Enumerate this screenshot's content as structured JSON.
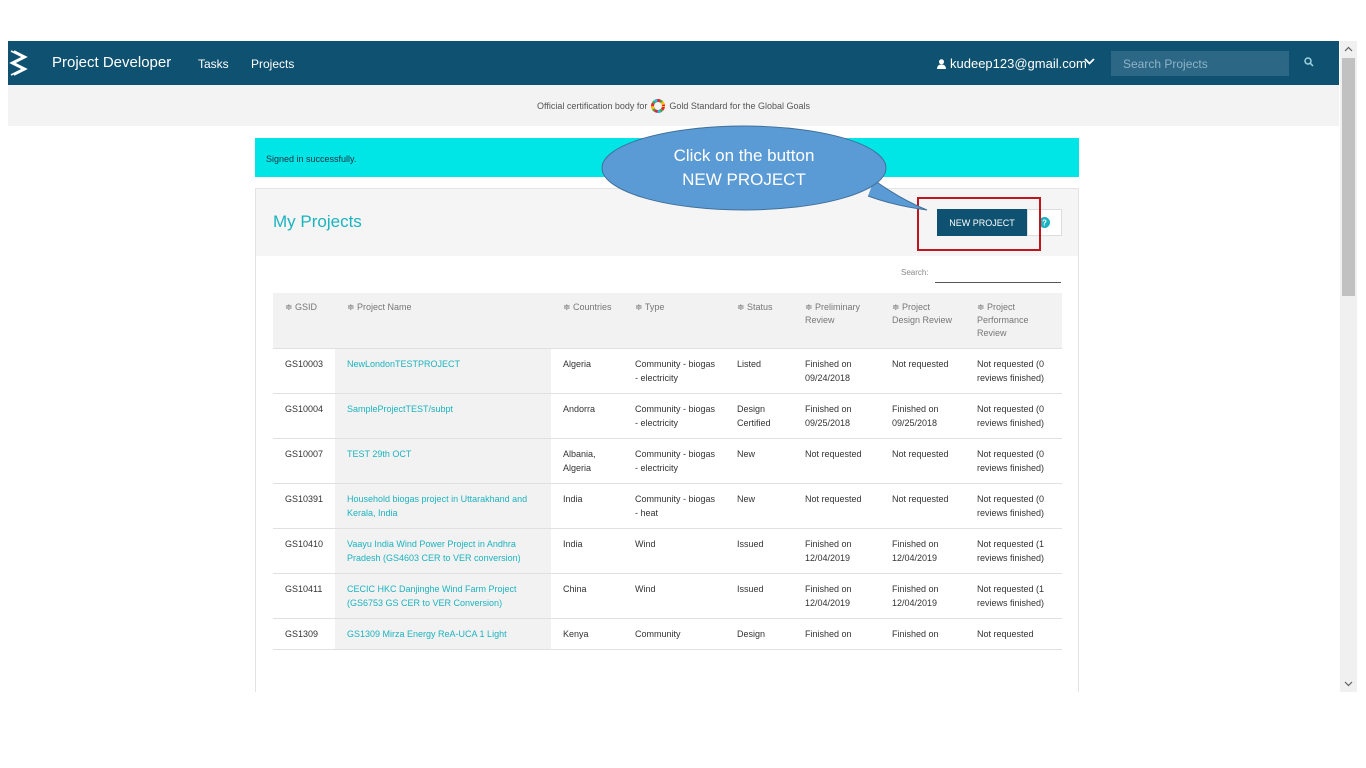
{
  "nav": {
    "brand": "Project Developer",
    "links": [
      "Tasks",
      "Projects"
    ],
    "user_email": "kudeep123@gmail.com",
    "search_placeholder": "Search Projects"
  },
  "cert_bar": {
    "prefix": "Official certification body for",
    "org": "Gold Standard for the Global Goals"
  },
  "alert": "Signed in successfully.",
  "panel": {
    "title": "My Projects",
    "new_project_label": "NEW PROJECT",
    "search_label": "Search:"
  },
  "callout": {
    "line1": "Click on the button",
    "line2": "NEW PROJECT"
  },
  "table": {
    "headers": [
      "≑ GSID",
      "≑ Project Name",
      "≑ Countries",
      "≑ Type",
      "≑ Status",
      "≑ Preliminary Review",
      "≑ Project Design Review",
      "≑ Project Performance Review"
    ],
    "rows": [
      [
        "GS10003",
        "NewLondonTESTPROJECT",
        "Algeria",
        "Community - biogas - electricity",
        "Listed",
        "Finished on 09/24/2018",
        "Not requested",
        "Not requested (0 reviews finished)"
      ],
      [
        "GS10004",
        "SampleProjectTEST/subpt",
        "Andorra",
        "Community - biogas - electricity",
        "Design Certified",
        "Finished on 09/25/2018",
        "Finished on 09/25/2018",
        "Not requested (0 reviews finished)"
      ],
      [
        "GS10007",
        "TEST 29th OCT",
        "Albania, Algeria",
        "Community - biogas - electricity",
        "New",
        "Not requested",
        "Not requested",
        "Not requested (0 reviews finished)"
      ],
      [
        "GS10391",
        "Household biogas project in Uttarakhand and Kerala, India",
        "India",
        "Community - biogas - heat",
        "New",
        "Not requested",
        "Not requested",
        "Not requested (0 reviews finished)"
      ],
      [
        "GS10410",
        "Vaayu India Wind Power Project in Andhra Pradesh (GS4603 CER to VER conversion)",
        "India",
        "Wind",
        "Issued",
        "Finished on 12/04/2019",
        "Finished on 12/04/2019",
        "Not requested (1 reviews finished)"
      ],
      [
        "GS10411",
        "CECIC HKC Danjinghe Wind Farm Project (GS6753 GS CER to VER Conversion)",
        "China",
        "Wind",
        "Issued",
        "Finished on 12/04/2019",
        "Finished on 12/04/2019",
        "Not requested (1 reviews finished)"
      ],
      [
        "GS1309",
        "GS1309 Mirza Energy ReA-UCA 1 Light",
        "Kenya",
        "Community",
        "Design",
        "Finished on",
        "Finished on",
        "Not requested"
      ]
    ]
  },
  "colors": {
    "navbar": "#0e5170",
    "accent": "#1bb3bf",
    "alert": "#00e5e5",
    "callout": "#5b9bd5",
    "highlight": "#c0151f"
  }
}
